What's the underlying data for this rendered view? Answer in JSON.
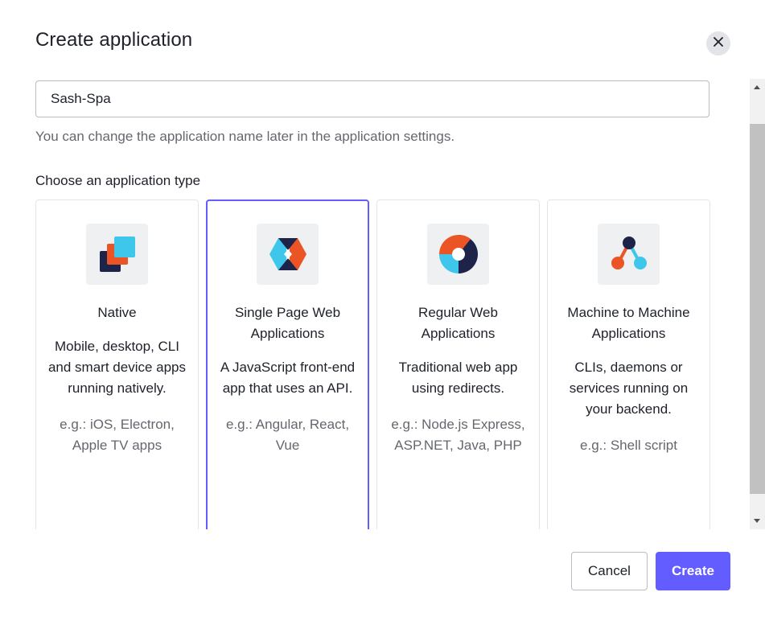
{
  "dialog": {
    "title": "Create application",
    "close_icon": "close-icon"
  },
  "name_field": {
    "value": "Sash-Spa",
    "helper": "You can change the application name later in the application settings."
  },
  "type_section": {
    "label": "Choose an application type",
    "cards": [
      {
        "icon": "native-app-icon",
        "title": "Native",
        "description": "Mobile, desktop, CLI and smart device apps running natively.",
        "examples": "e.g.: iOS, Electron, Apple TV apps",
        "selected": false
      },
      {
        "icon": "spa-app-icon",
        "title": "Single Page Web Applications",
        "description": "A JavaScript front-end app that uses an API.",
        "examples": "e.g.: Angular, React, Vue",
        "selected": true
      },
      {
        "icon": "regular-web-app-icon",
        "title": "Regular Web Applications",
        "description": "Traditional web app using redirects.",
        "examples": "e.g.: Node.js Express, ASP.NET, Java, PHP",
        "selected": false
      },
      {
        "icon": "m2m-app-icon",
        "title": "Machine to Machine Applications",
        "description": "CLIs, daemons or services running on your backend.",
        "examples": "e.g.: Shell script",
        "selected": false
      }
    ]
  },
  "footer": {
    "cancel_label": "Cancel",
    "create_label": "Create"
  },
  "colors": {
    "accent": "#635dff",
    "icon_blue": "#3ec6eb",
    "icon_navy": "#1e2449",
    "icon_orange": "#eb5424"
  }
}
